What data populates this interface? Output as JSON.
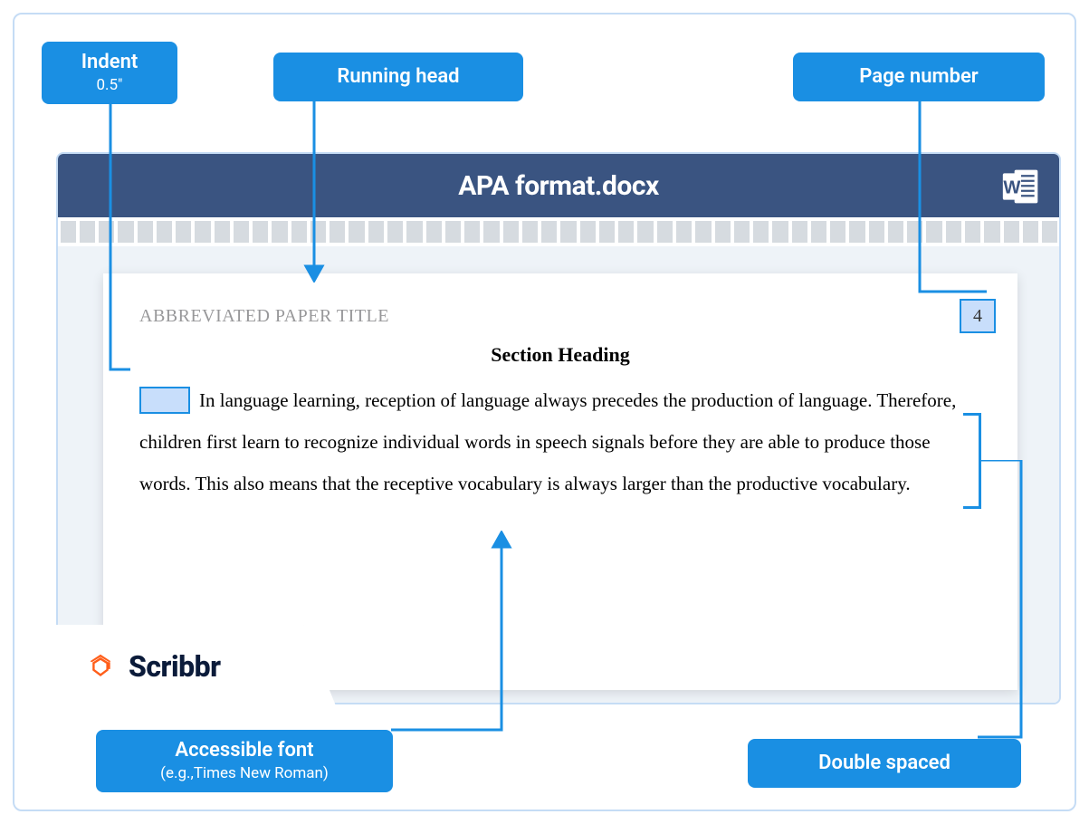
{
  "labels": {
    "indent": {
      "title": "Indent",
      "sub": "0.5\""
    },
    "running_head": "Running head",
    "page_number": "Page number",
    "accessible_font": {
      "title": "Accessible font",
      "sub": "(e.g.,Times New Roman)"
    },
    "double_spaced": "Double spaced"
  },
  "document": {
    "filename": "APA format.docx",
    "running_head_text": "ABBREVIATED PAPER TITLE",
    "page_number": "4",
    "section_heading": "Section Heading",
    "body_text": "In language learning, reception of language always precedes the production of language. Therefore, children first learn to recognize individual words in speech signals before they are able to produce those words. This also means that the receptive vocabulary is always larger than the productive vocabulary."
  },
  "brand": {
    "name": "Scribbr"
  }
}
